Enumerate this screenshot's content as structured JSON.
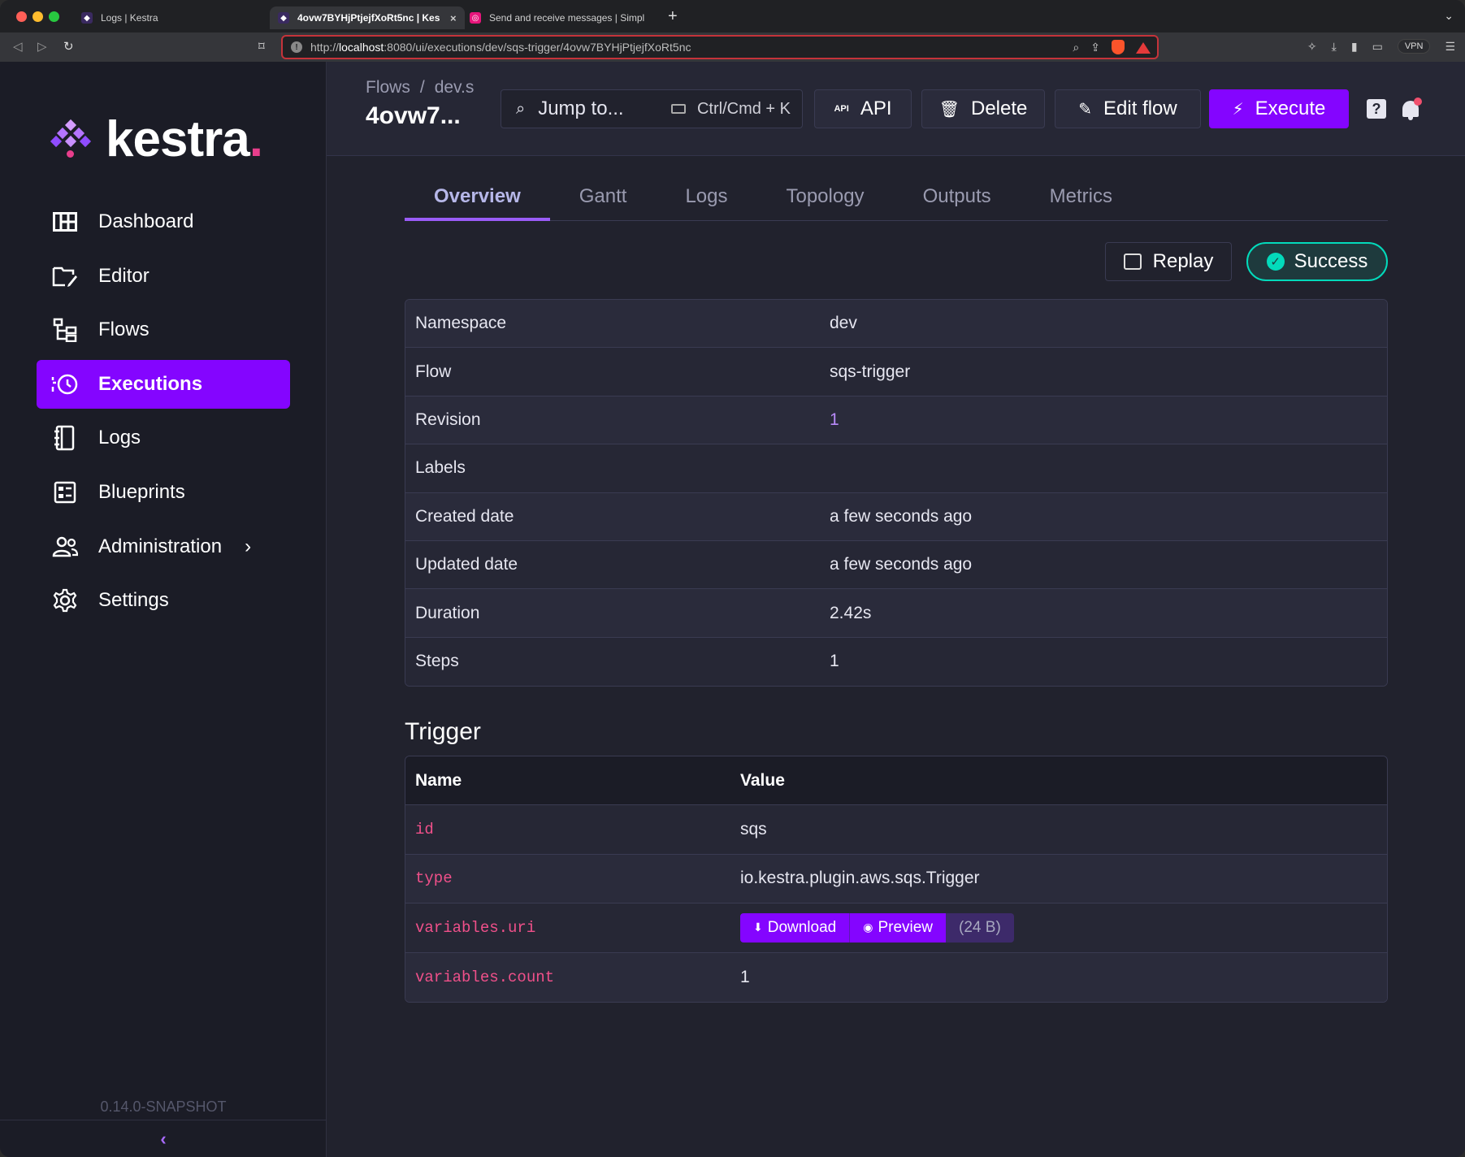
{
  "browser": {
    "tabs": [
      {
        "title": "Logs | Kestra"
      },
      {
        "title": "4ovw7BYHjPtjejfXoRt5nc | Kes"
      },
      {
        "title": "Send and receive messages | Simpl"
      }
    ],
    "url_prefix": "http://",
    "url_host": "localhost",
    "url_rest": ":8080/ui/executions/dev/sqs-trigger/4ovw7BYHjPtjejfXoRt5nc",
    "vpn_label": "VPN",
    "new_tab_glyph": "+",
    "close_tab_glyph": "×"
  },
  "sidebar": {
    "logo_text": "kestra",
    "logo_dot": ".",
    "items": [
      {
        "label": "Dashboard",
        "icon": "dashboard-icon"
      },
      {
        "label": "Editor",
        "icon": "editor-icon"
      },
      {
        "label": "Flows",
        "icon": "flows-icon"
      },
      {
        "label": "Executions",
        "icon": "executions-icon",
        "active": true
      },
      {
        "label": "Logs",
        "icon": "logs-icon"
      },
      {
        "label": "Blueprints",
        "icon": "blueprints-icon"
      },
      {
        "label": "Administration",
        "icon": "administration-icon",
        "has_children": true
      },
      {
        "label": "Settings",
        "icon": "settings-icon"
      }
    ],
    "version": "0.14.0-SNAPSHOT"
  },
  "header": {
    "breadcrumb": [
      "Flows",
      "dev.s"
    ],
    "breadcrumb_sep": "/",
    "title": "4ovw7...",
    "jump_placeholder": "Jump to...",
    "jump_shortcut": "Ctrl/Cmd + K",
    "api_label": "API",
    "api_badge": "API",
    "delete_label": "Delete",
    "edit_label": "Edit flow",
    "execute_label": "Execute",
    "help_glyph": "?"
  },
  "tabs": [
    "Overview",
    "Gantt",
    "Logs",
    "Topology",
    "Outputs",
    "Metrics"
  ],
  "active_tab": "Overview",
  "actions": {
    "replay_label": "Replay",
    "status_label": "Success"
  },
  "overview": [
    {
      "key": "Namespace",
      "value": "dev"
    },
    {
      "key": "Flow",
      "value": "sqs-trigger"
    },
    {
      "key": "Revision",
      "value": "1",
      "link": true
    },
    {
      "key": "Labels",
      "value": ""
    },
    {
      "key": "Created date",
      "value": "a few seconds ago"
    },
    {
      "key": "Updated date",
      "value": "a few seconds ago"
    },
    {
      "key": "Duration",
      "value": "2.42s"
    },
    {
      "key": "Steps",
      "value": "1"
    }
  ],
  "trigger": {
    "title": "Trigger",
    "columns": [
      "Name",
      "Value"
    ],
    "rows": [
      {
        "name": "id",
        "value": "sqs"
      },
      {
        "name": "type",
        "value": "io.kestra.plugin.aws.sqs.Trigger"
      },
      {
        "name": "variables.uri",
        "value": "",
        "download_label": "Download",
        "preview_label": "Preview",
        "size": "(24 B)"
      },
      {
        "name": "variables.count",
        "value": "1"
      }
    ]
  },
  "colors": {
    "accent": "#8405ff",
    "success": "#03dabb",
    "key_pink": "#f0508a"
  }
}
